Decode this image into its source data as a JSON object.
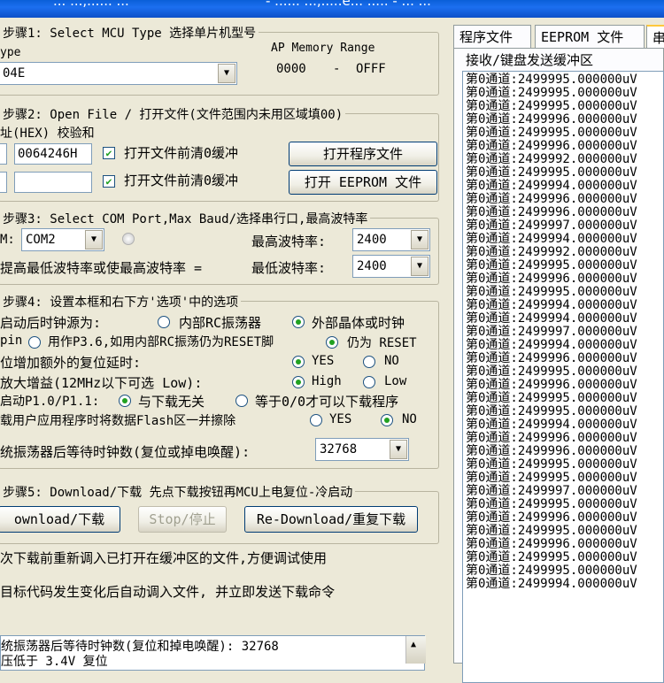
{
  "titlebar": {
    "left": "... ...,...... ...",
    "right": "- ...... ...,.....e... ..... - ... ..."
  },
  "step1": {
    "title": "步骤1: Select MCU Type  选择单片机型号",
    "type_label": "ype",
    "mcu_value": "04E",
    "ap_memory_label": "AP Memory Range",
    "range_from": "0000",
    "range_sep": "-",
    "range_to": "OFFF"
  },
  "step2": {
    "title": "步骤2: Open File / 打开文件(文件范围内未用区域填00)",
    "sub_label": "址(HEX) 校验和",
    "checksum1": "0064246H",
    "checksum2": "",
    "clear_label1": "打开文件前清0缓冲",
    "clear_label2": "打开文件前清0缓冲",
    "open_program_button": "打开程序文件",
    "open_eeprom_button": "打开 EEPROM 文件"
  },
  "step3": {
    "title": "步骤3: Select COM Port,Max Baud/选择串行口,最高波特率",
    "com_label": "M:",
    "com_value": "COM2",
    "max_baud_label": "最高波特率:",
    "max_baud_value": "2400",
    "hint": "提高最低波特率或使最高波特率 =",
    "min_baud_label": "最低波特率:",
    "min_baud_value": "2400"
  },
  "step4": {
    "title": "步骤4: 设置本框和右下方'选项'中的选项",
    "clock_label": "启动后时钟源为:",
    "clock_opt1": "内部RC振荡器",
    "clock_opt2": "外部晶体或时钟",
    "pin_label": "pin",
    "pin_opt1": "用作P3.6,如用内部RC振荡仍为RESET脚",
    "pin_opt2": "仍为 RESET",
    "reset_delay_label": "位增加额外的复位延时:",
    "reset_yes": "YES",
    "reset_no": "NO",
    "gain_label": "放大增益(12MHz以下可选 Low):",
    "gain_high": "High",
    "gain_low": "Low",
    "p10_label": "启动P1.0/P1.1:",
    "p10_opt1": "与下载无关",
    "p10_opt2": "等于0/0才可以下载程序",
    "flash_label": "载用户应用程序时将数据Flash区一并擦除",
    "flash_yes": "YES",
    "flash_no": "NO",
    "wait_label": "统振荡器后等待时钟数(复位或掉电唤醒):",
    "wait_value": "32768"
  },
  "step5": {
    "title": "步骤5: Download/下载  先点下载按钮再MCU上电复位-冷启动",
    "download_button": "ownload/下载",
    "stop_button": "Stop/停止",
    "redownload_button": "Re-Download/重复下载",
    "note1": "次下载前重新调入已打开在缓冲区的文件,方便调试使用",
    "note2": "目标代码发生变化后自动调入文件, 并立即发送下载命令"
  },
  "status": {
    "line1": "统振荡器后等待时钟数(复位和掉电唤醒): 32768",
    "line2": "压低于 3.4V 复位"
  },
  "tabs": {
    "program": "程序文件",
    "eeprom": "EEPROM 文件",
    "serial": "串"
  },
  "log": {
    "group_title": "接收/键盘发送缓冲区",
    "lines": [
      "第0通道:2499995.000000uV",
      "第0通道:2499995.000000uV",
      "第0通道:2499995.000000uV",
      "第0通道:2499996.000000uV",
      "第0通道:2499995.000000uV",
      "第0通道:2499996.000000uV",
      "第0通道:2499992.000000uV",
      "第0通道:2499995.000000uV",
      "第0通道:2499994.000000uV",
      "第0通道:2499996.000000uV",
      "第0通道:2499996.000000uV",
      "第0通道:2499997.000000uV",
      "第0通道:2499994.000000uV",
      "第0通道:2499992.000000uV",
      "第0通道:2499995.000000uV",
      "第0通道:2499996.000000uV",
      "第0通道:2499995.000000uV",
      "第0通道:2499994.000000uV",
      "第0通道:2499994.000000uV",
      "第0通道:2499997.000000uV",
      "第0通道:2499994.000000uV",
      "第0通道:2499996.000000uV",
      "第0通道:2499995.000000uV",
      "第0通道:2499996.000000uV",
      "第0通道:2499995.000000uV",
      "第0通道:2499995.000000uV",
      "第0通道:2499994.000000uV",
      "第0通道:2499996.000000uV",
      "第0通道:2499996.000000uV",
      "第0通道:2499995.000000uV",
      "第0通道:2499995.000000uV",
      "第0通道:2499997.000000uV",
      "第0通道:2499995.000000uV",
      "第0通道:2499996.000000uV",
      "第0通道:2499995.000000uV",
      "第0通道:2499996.000000uV",
      "第0通道:2499995.000000uV",
      "第0通道:2499995.000000uV",
      "第0通道:2499994.000000uV"
    ]
  }
}
